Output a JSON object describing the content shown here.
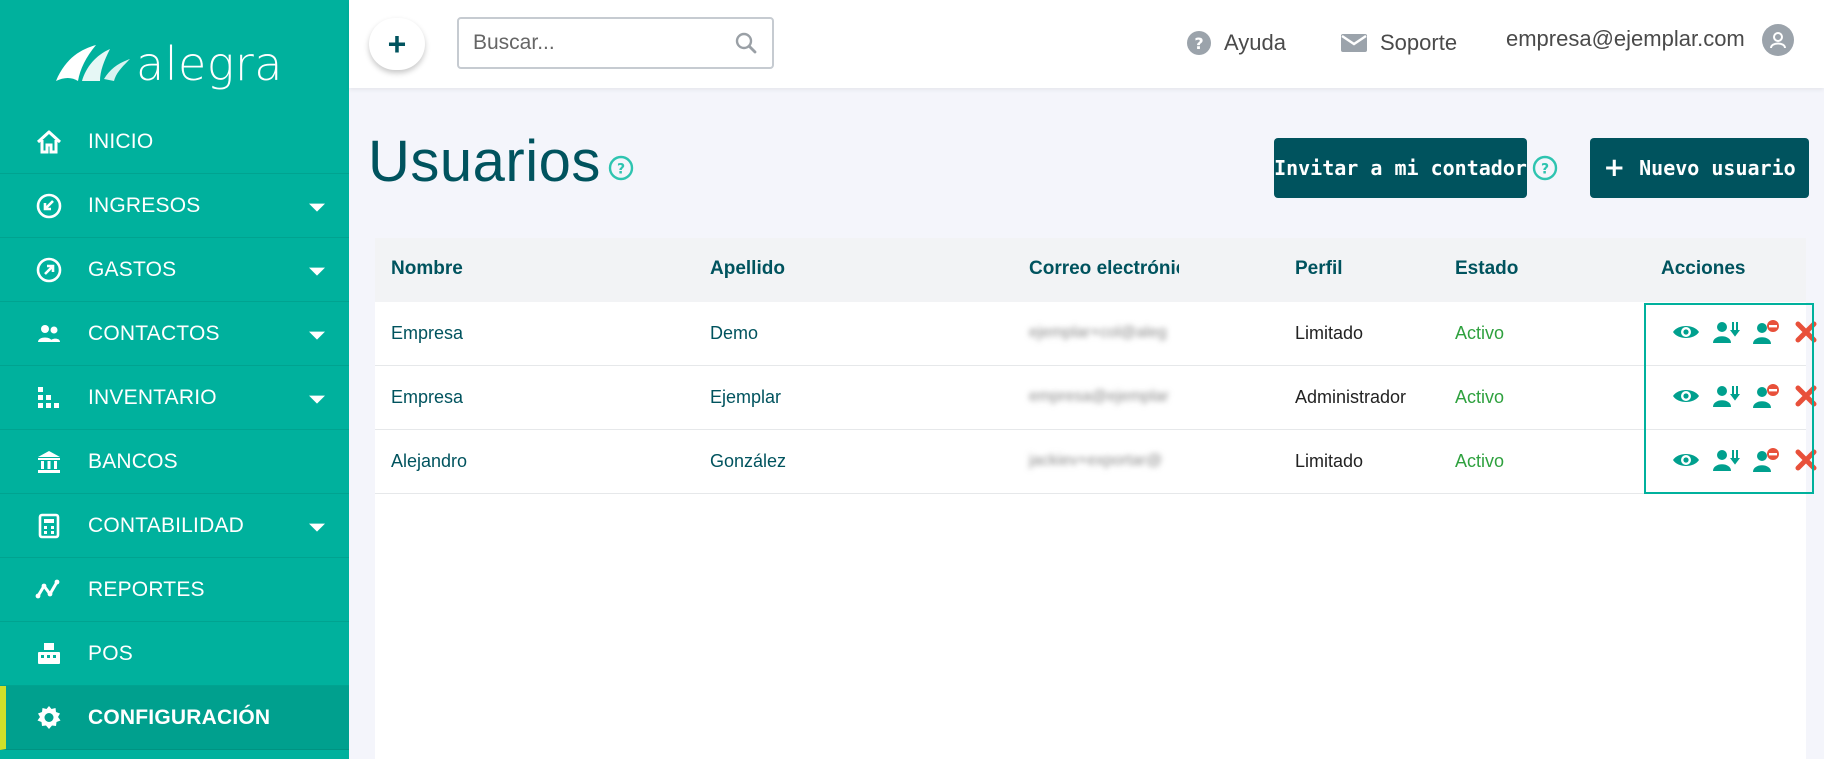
{
  "brand": {
    "name": "alegra"
  },
  "sidebar": {
    "items": [
      {
        "label": "INICIO",
        "icon": "home-icon",
        "has_submenu": false
      },
      {
        "label": "INGRESOS",
        "icon": "income-arrow-icon",
        "has_submenu": true
      },
      {
        "label": "GASTOS",
        "icon": "expense-arrow-icon",
        "has_submenu": true
      },
      {
        "label": "CONTACTOS",
        "icon": "contacts-icon",
        "has_submenu": true
      },
      {
        "label": "INVENTARIO",
        "icon": "inventory-icon",
        "has_submenu": true
      },
      {
        "label": "BANCOS",
        "icon": "bank-icon",
        "has_submenu": false
      },
      {
        "label": "CONTABILIDAD",
        "icon": "accounting-icon",
        "has_submenu": true
      },
      {
        "label": "REPORTES",
        "icon": "reports-icon",
        "has_submenu": false
      },
      {
        "label": "POS",
        "icon": "pos-icon",
        "has_submenu": false
      },
      {
        "label": "CONFIGURACIÓN",
        "icon": "gear-icon",
        "has_submenu": false,
        "active": true
      }
    ]
  },
  "topbar": {
    "add_label": "+",
    "search_placeholder": "Buscar...",
    "help_label": "Ayuda",
    "support_label": "Soporte",
    "user_email": "empresa@ejemplar.com"
  },
  "page": {
    "title": "Usuarios",
    "invite_button": "Invitar a mi contador",
    "new_user_button": "Nuevo usuario",
    "new_user_plus": "+"
  },
  "table": {
    "headers": {
      "name": "Nombre",
      "lastname": "Apellido",
      "email": "Correo electrónico",
      "profile": "Perfil",
      "status": "Estado",
      "actions": "Acciones"
    },
    "rows": [
      {
        "name": "Empresa",
        "lastname": "Demo",
        "email": "ejemplar+col@aleg",
        "profile": "Limitado",
        "status": "Activo"
      },
      {
        "name": "Empresa",
        "lastname": "Ejemplar",
        "email": "empresa@ejemplar",
        "profile": "Administrador",
        "status": "Activo"
      },
      {
        "name": "Alejandro",
        "lastname": "González",
        "email": "jackiev+exportar@",
        "profile": "Limitado",
        "status": "Activo"
      }
    ]
  },
  "colors": {
    "sidebar": "#00b19d",
    "primary_dark": "#00535e",
    "active_accent": "#cfe02a",
    "status_active": "#2fa13f",
    "delete": "#e8503a"
  }
}
